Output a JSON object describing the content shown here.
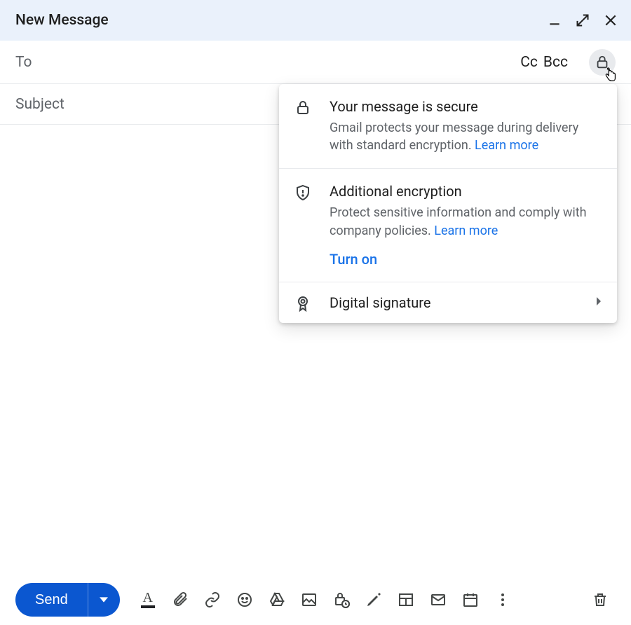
{
  "header": {
    "title": "New Message"
  },
  "recipients": {
    "to_label": "To",
    "cc_label": "Cc",
    "bcc_label": "Bcc"
  },
  "subject": {
    "placeholder": "Subject"
  },
  "security_popover": {
    "secure": {
      "title": "Your message is secure",
      "body": "Gmail protects your message during delivery with standard encryption. ",
      "learn_more": "Learn more"
    },
    "additional": {
      "title": "Additional encryption",
      "body": "Protect sensitive information and comply with company policies. ",
      "learn_more": "Learn more",
      "action": "Turn on"
    },
    "signature": {
      "title": "Digital signature"
    }
  },
  "toolbar": {
    "send_label": "Send"
  },
  "colors": {
    "accent": "#0b57d0",
    "link": "#1a73e8"
  }
}
